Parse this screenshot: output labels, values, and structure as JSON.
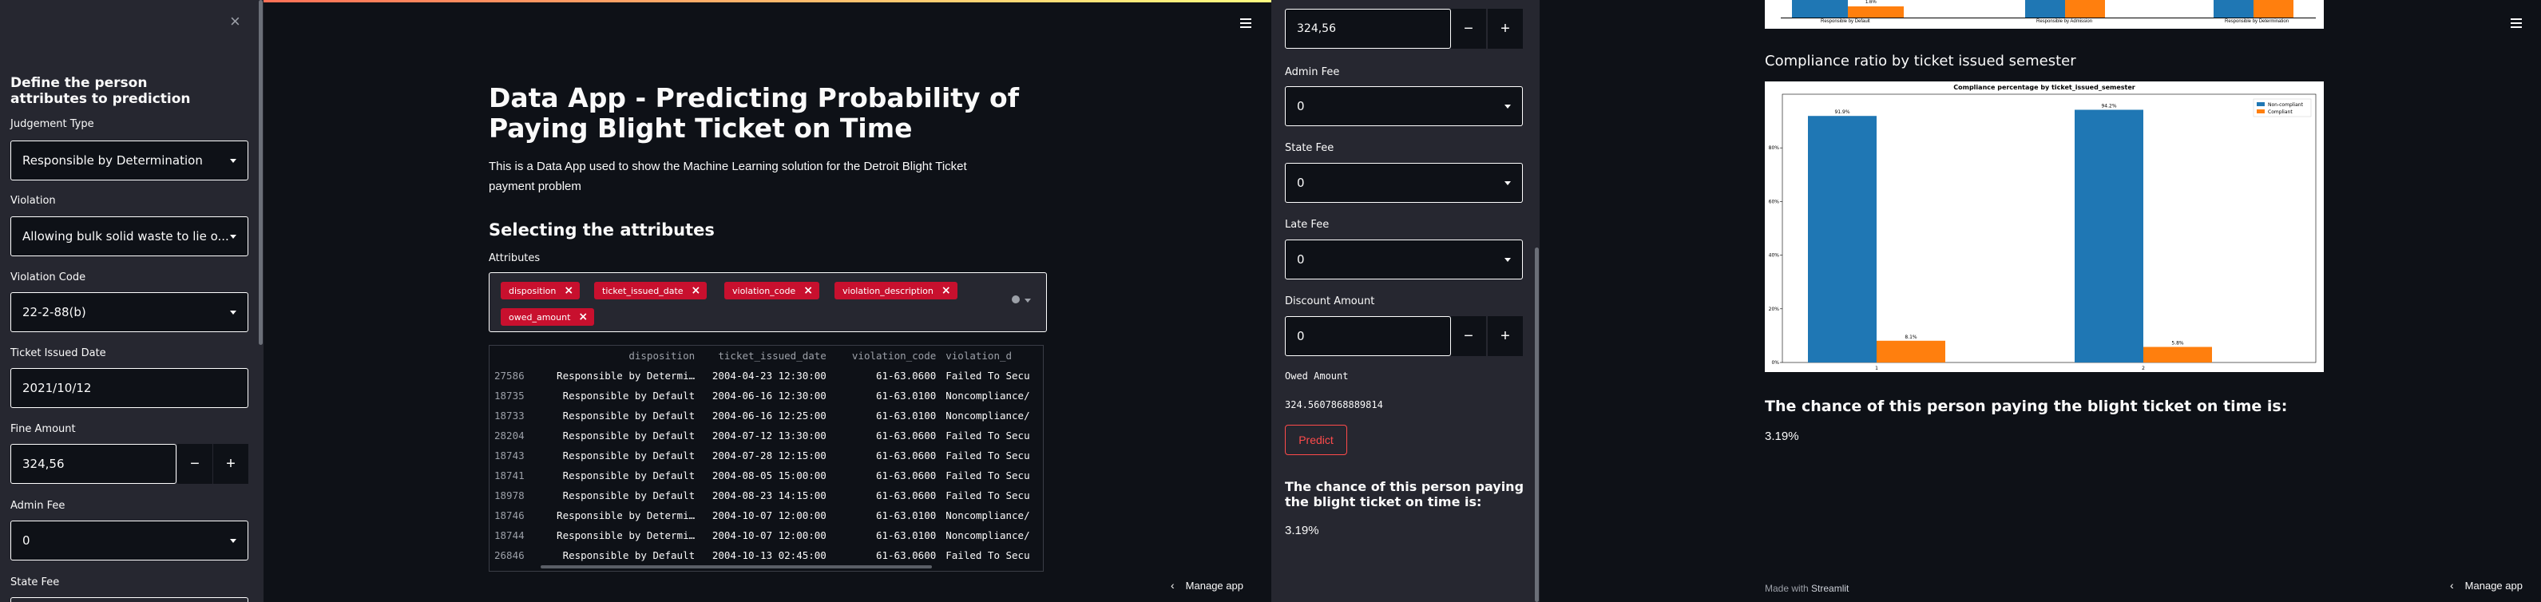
{
  "left": {
    "sidebar": {
      "title": "Define the person attributes to prediction",
      "judgement_type": {
        "label": "Judgement Type",
        "value": "Responsible by Determination"
      },
      "violation": {
        "label": "Violation",
        "value": "Allowing bulk solid waste to lie o..."
      },
      "violation_code": {
        "label": "Violation Code",
        "value": "22-2-88(b)"
      },
      "ticket_issued_date": {
        "label": "Ticket Issued Date",
        "value": "2021/10/12"
      },
      "fine_amount": {
        "label": "Fine Amount",
        "value": "324,56"
      },
      "admin_fee": {
        "label": "Admin Fee",
        "value": "0"
      },
      "state_fee": {
        "label": "State Fee"
      },
      "minus": "−",
      "plus": "+",
      "close": "×"
    },
    "main": {
      "title": "Data App - Predicting Probability of Paying Blight Ticket on Time",
      "description": "This is a Data App used to show the Machine Learning solution for the Detroit Blight Ticket payment problem",
      "section_heading": "Selecting the attributes",
      "attributes_label": "Attributes",
      "tags": [
        "disposition",
        "ticket_issued_date",
        "violation_code",
        "violation_description",
        "owed_amount"
      ],
      "table": {
        "columns": [
          "",
          "disposition",
          "ticket_issued_date",
          "violation_code",
          "violation_d"
        ],
        "rows": [
          [
            "27586",
            "Responsible by Determi…",
            "2004-04-23 12:30:00",
            "61-63.0600",
            "Failed To Secu"
          ],
          [
            "18735",
            "Responsible by Default",
            "2004-06-16 12:30:00",
            "61-63.0100",
            "Noncompliance/"
          ],
          [
            "18733",
            "Responsible by Default",
            "2004-06-16 12:25:00",
            "61-63.0100",
            "Noncompliance/"
          ],
          [
            "28204",
            "Responsible by Default",
            "2004-07-12 13:30:00",
            "61-63.0600",
            "Failed To Secu"
          ],
          [
            "18743",
            "Responsible by Default",
            "2004-07-28 12:15:00",
            "61-63.0600",
            "Failed To Secu"
          ],
          [
            "18741",
            "Responsible by Default",
            "2004-08-05 15:00:00",
            "61-63.0600",
            "Failed To Secu"
          ],
          [
            "18978",
            "Responsible by Default",
            "2004-08-23 14:15:00",
            "61-63.0600",
            "Failed To Secu"
          ],
          [
            "18746",
            "Responsible by Determi…",
            "2004-10-07 12:00:00",
            "61-63.0100",
            "Noncompliance/"
          ],
          [
            "18744",
            "Responsible by Determi…",
            "2004-10-07 12:00:00",
            "61-63.0100",
            "Noncompliance/"
          ],
          [
            "26846",
            "Responsible by Default",
            "2004-10-13 02:45:00",
            "61-63.0600",
            "Failed To Secu"
          ]
        ]
      },
      "manage_app": "Manage app"
    }
  },
  "middle": {
    "fine_amount_value": "324,56",
    "admin_fee": {
      "label": "Admin Fee",
      "value": "0"
    },
    "state_fee": {
      "label": "State Fee",
      "value": "0"
    },
    "late_fee": {
      "label": "Late Fee",
      "value": "0"
    },
    "discount_amount": {
      "label": "Discount Amount",
      "value": "0"
    },
    "owed_amount": {
      "label": "Owed Amount",
      "value": "324.5607868889814"
    },
    "predict_button": "Predict",
    "result_heading": "The chance of this person paying the blight ticket on time is:",
    "result_value": "3.19%"
  },
  "right": {
    "top_chart_labels": [
      "Responsible by Default",
      "Responsible by Admission",
      "Responsible by Determination"
    ],
    "top_chart_value": "1.6%",
    "section_heading": "Compliance ratio by ticket issued semester",
    "result_heading": "The chance of this person paying the blight ticket on time is:",
    "result_value": "3.19%",
    "made_with": "Made with",
    "streamlit": "Streamlit",
    "manage_app": "Manage app"
  },
  "chart_data": {
    "type": "bar",
    "title": "Compliance percentage by ticket_issued_semester",
    "categories": [
      "1",
      "2"
    ],
    "series": [
      {
        "name": "Non-compliant",
        "values": [
          91.9,
          94.2
        ],
        "labels": [
          "91.9%",
          "94.2%"
        ],
        "color": "#1f77b4"
      },
      {
        "name": "Compliant",
        "values": [
          8.1,
          5.8
        ],
        "labels": [
          "8.1%",
          "5.8%"
        ],
        "color": "#ff7f0e"
      }
    ],
    "ylim": [
      0,
      100
    ],
    "yticks": [
      "0%",
      "20%",
      "40%",
      "60%",
      "80%"
    ],
    "legend": "top-right"
  },
  "colors": {
    "background": "#0e1117",
    "sidebar": "#262730",
    "accent": "#ff4b4b",
    "tag": "#c8102e"
  }
}
